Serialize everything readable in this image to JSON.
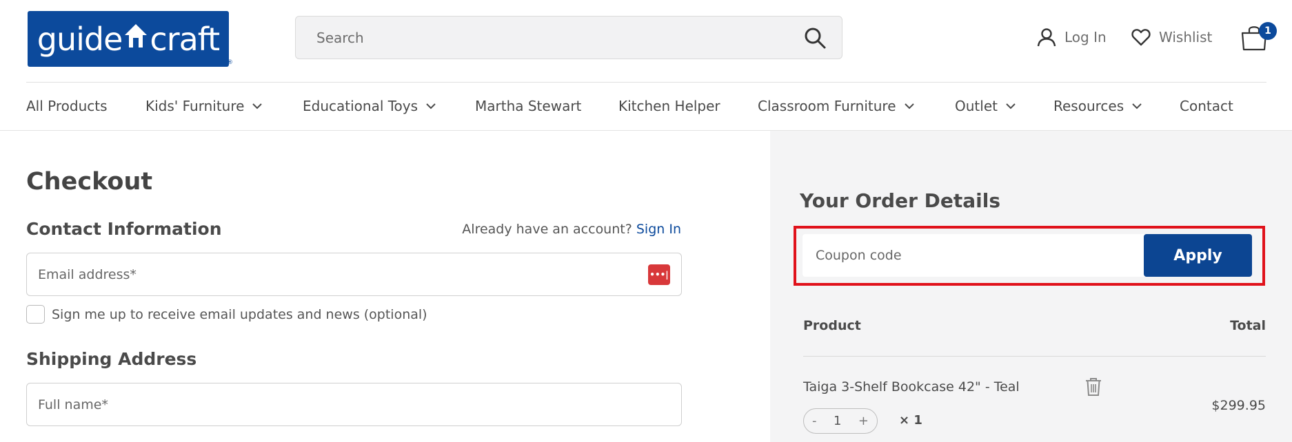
{
  "header": {
    "logo_text_left": "guide",
    "logo_text_right": "craft",
    "logo_reg": "®",
    "search": {
      "placeholder": "Search"
    },
    "login_label": "Log In",
    "wishlist_label": "Wishlist",
    "cart_count": "1"
  },
  "nav": {
    "items": [
      {
        "label": "All Products",
        "dropdown": false
      },
      {
        "label": "Kids' Furniture",
        "dropdown": true
      },
      {
        "label": "Educational Toys",
        "dropdown": true
      },
      {
        "label": "Martha Stewart",
        "dropdown": false
      },
      {
        "label": "Kitchen Helper",
        "dropdown": false
      },
      {
        "label": "Classroom Furniture",
        "dropdown": true
      },
      {
        "label": "Outlet",
        "dropdown": true
      },
      {
        "label": "Resources",
        "dropdown": true
      },
      {
        "label": "Contact",
        "dropdown": false
      }
    ]
  },
  "checkout": {
    "title": "Checkout",
    "contact_heading": "Contact Information",
    "account_prompt": "Already have an account?",
    "sign_in_label": "Sign In",
    "email_placeholder": "Email address*",
    "password_manager_icon": "•••|",
    "newsletter_label": "Sign me up to receive email updates and news (optional)",
    "shipping_heading": "Shipping Address",
    "fullname_placeholder": "Full name*"
  },
  "order": {
    "title": "Your Order Details",
    "coupon_placeholder": "Coupon code",
    "apply_label": "Apply",
    "col_product": "Product",
    "col_total": "Total",
    "items": [
      {
        "name": "Taiga 3-Shelf Bookcase 42\" - Teal",
        "qty": "1",
        "times": "× 1",
        "total": "$299.95"
      }
    ],
    "stepper_minus": "-",
    "stepper_plus": "+"
  },
  "colors": {
    "brand_blue": "#0c4a9c",
    "apply_blue": "#0c4592",
    "highlight_red": "#e0121b",
    "panel_gray": "#f4f4f5"
  }
}
